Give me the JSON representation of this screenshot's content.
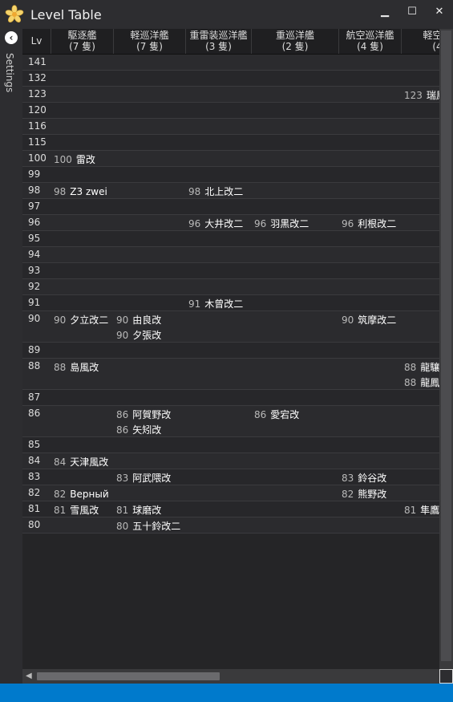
{
  "window": {
    "title": "Level Table",
    "min_glyph": "▁",
    "max_glyph": "☐",
    "close_glyph": "✕",
    "icon": "star-flower-icon"
  },
  "sidebar": {
    "label": "Settings",
    "collapse_glyph": "‹"
  },
  "header": {
    "lv": "Lv",
    "columns": [
      {
        "name": "駆逐艦",
        "count": "(7 隻)"
      },
      {
        "name": "軽巡洋艦",
        "count": "(7 隻)"
      },
      {
        "name": "重雷装巡洋艦",
        "count": "(3 隻)"
      },
      {
        "name": "重巡洋艦",
        "count": "(2 隻)"
      },
      {
        "name": "航空巡洋艦",
        "count": "(4 隻)"
      },
      {
        "name": "軽空母",
        "count": "(4"
      }
    ]
  },
  "rows": [
    {
      "lv": "141",
      "cells": [
        [],
        [],
        [],
        [],
        [],
        []
      ]
    },
    {
      "lv": "132",
      "cells": [
        [],
        [],
        [],
        [],
        [],
        []
      ]
    },
    {
      "lv": "123",
      "cells": [
        [],
        [],
        [],
        [],
        [],
        [
          {
            "n": "123",
            "name": "瑞鳳"
          }
        ]
      ]
    },
    {
      "lv": "120",
      "cells": [
        [],
        [],
        [],
        [],
        [],
        []
      ]
    },
    {
      "lv": "116",
      "cells": [
        [],
        [],
        [],
        [],
        [],
        []
      ]
    },
    {
      "lv": "115",
      "cells": [
        [],
        [],
        [],
        [],
        [],
        []
      ]
    },
    {
      "lv": "100",
      "cells": [
        [
          {
            "n": "100",
            "name": "雷改"
          }
        ],
        [],
        [],
        [],
        [],
        []
      ]
    },
    {
      "lv": "99",
      "cells": [
        [],
        [],
        [],
        [],
        [],
        []
      ]
    },
    {
      "lv": "98",
      "cells": [
        [
          {
            "n": "98",
            "name": "Z3 zwei"
          }
        ],
        [],
        [
          {
            "n": "98",
            "name": "北上改二"
          }
        ],
        [],
        [],
        []
      ]
    },
    {
      "lv": "97",
      "cells": [
        [],
        [],
        [],
        [],
        [],
        []
      ]
    },
    {
      "lv": "96",
      "cells": [
        [],
        [],
        [
          {
            "n": "96",
            "name": "大井改二"
          }
        ],
        [
          {
            "n": "96",
            "name": "羽黒改二"
          }
        ],
        [
          {
            "n": "96",
            "name": "利根改二"
          }
        ],
        []
      ]
    },
    {
      "lv": "95",
      "cells": [
        [],
        [],
        [],
        [],
        [],
        []
      ]
    },
    {
      "lv": "94",
      "cells": [
        [],
        [],
        [],
        [],
        [],
        []
      ]
    },
    {
      "lv": "93",
      "cells": [
        [],
        [],
        [],
        [],
        [],
        []
      ]
    },
    {
      "lv": "92",
      "cells": [
        [],
        [],
        [],
        [],
        [],
        []
      ]
    },
    {
      "lv": "91",
      "cells": [
        [],
        [],
        [
          {
            "n": "91",
            "name": "木曾改二"
          }
        ],
        [],
        [],
        []
      ]
    },
    {
      "lv": "90",
      "cells": [
        [
          {
            "n": "90",
            "name": "夕立改二"
          }
        ],
        [
          {
            "n": "90",
            "name": "由良改"
          },
          {
            "n": "90",
            "name": "夕張改"
          }
        ],
        [],
        [],
        [
          {
            "n": "90",
            "name": "筑摩改二"
          }
        ],
        []
      ]
    },
    {
      "lv": "89",
      "cells": [
        [],
        [],
        [],
        [],
        [],
        []
      ]
    },
    {
      "lv": "88",
      "cells": [
        [
          {
            "n": "88",
            "name": "島風改"
          }
        ],
        [],
        [],
        [],
        [],
        [
          {
            "n": "88",
            "name": "龍驤"
          },
          {
            "n": "88",
            "name": "龍鳳"
          }
        ]
      ]
    },
    {
      "lv": "87",
      "cells": [
        [],
        [],
        [],
        [],
        [],
        []
      ]
    },
    {
      "lv": "86",
      "cells": [
        [],
        [
          {
            "n": "86",
            "name": "阿賀野改"
          },
          {
            "n": "86",
            "name": "矢矧改"
          }
        ],
        [],
        [
          {
            "n": "86",
            "name": "愛宕改"
          }
        ],
        [],
        []
      ]
    },
    {
      "lv": "85",
      "cells": [
        [],
        [],
        [],
        [],
        [],
        []
      ]
    },
    {
      "lv": "84",
      "cells": [
        [
          {
            "n": "84",
            "name": "天津風改"
          }
        ],
        [],
        [],
        [],
        [],
        []
      ]
    },
    {
      "lv": "83",
      "cells": [
        [],
        [
          {
            "n": "83",
            "name": "阿武隈改"
          }
        ],
        [],
        [],
        [
          {
            "n": "83",
            "name": "鈴谷改"
          }
        ],
        []
      ]
    },
    {
      "lv": "82",
      "cells": [
        [
          {
            "n": "82",
            "name": "Верный"
          }
        ],
        [],
        [],
        [],
        [
          {
            "n": "82",
            "name": "熊野改"
          }
        ],
        []
      ]
    },
    {
      "lv": "81",
      "cells": [
        [
          {
            "n": "81",
            "name": "雪風改"
          }
        ],
        [
          {
            "n": "81",
            "name": "球磨改"
          }
        ],
        [],
        [],
        [],
        [
          {
            "n": "81",
            "name": "隼鷹"
          }
        ]
      ]
    },
    {
      "lv": "80",
      "cells": [
        [],
        [
          {
            "n": "80",
            "name": "五十鈴改二"
          }
        ],
        [],
        [],
        [],
        []
      ]
    }
  ]
}
